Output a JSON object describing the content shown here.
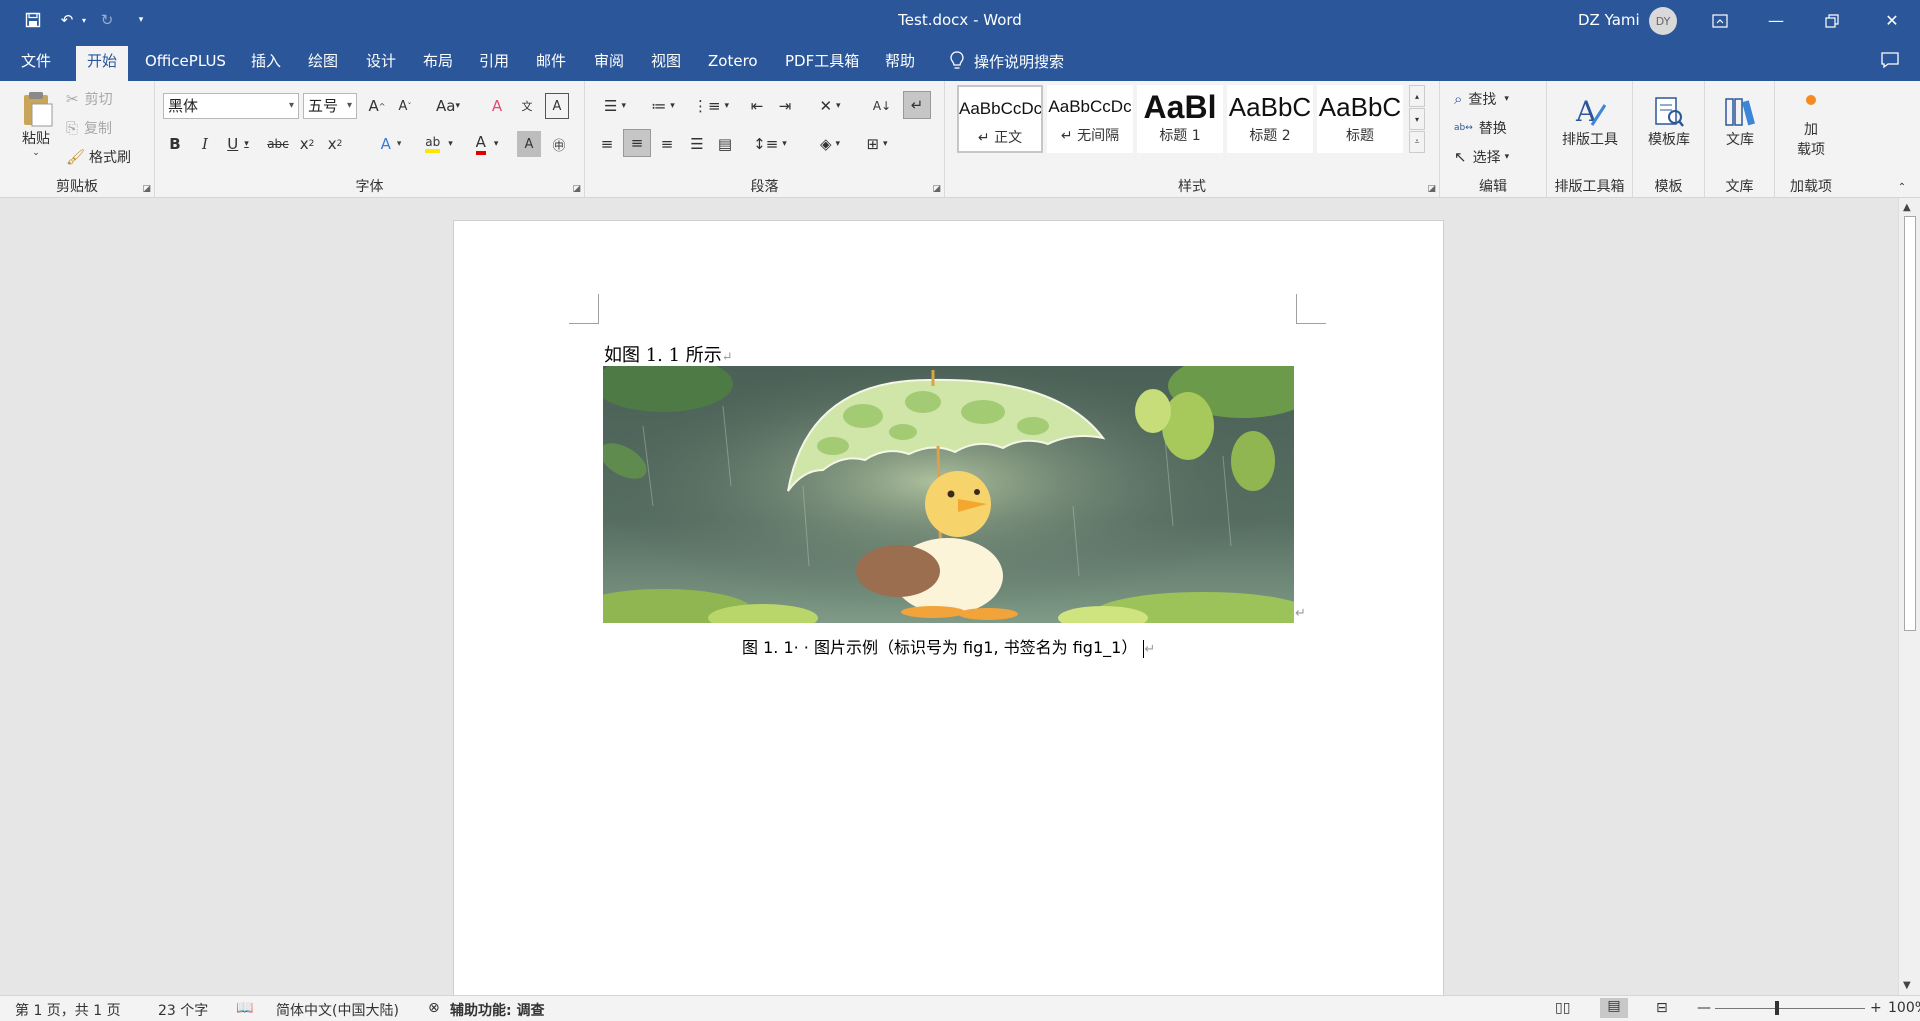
{
  "titlebar": {
    "title": "Test.docx - Word",
    "user": "DZ Yami",
    "avatar_initials": "DY",
    "qat": [
      "save-icon",
      "undo-icon",
      "redo-icon",
      "customize-qat-icon"
    ]
  },
  "tabs": [
    "文件",
    "开始",
    "OfficePLUS",
    "插入",
    "绘图",
    "设计",
    "布局",
    "引用",
    "邮件",
    "审阅",
    "视图",
    "Zotero",
    "PDF工具箱",
    "帮助"
  ],
  "active_tab": "开始",
  "tell_me": "操作说明搜索",
  "clipboard": {
    "paste": "粘贴",
    "cut": "剪切",
    "copy": "复制",
    "format_painter": "格式刷",
    "label": "剪贴板"
  },
  "font": {
    "name": "黑体",
    "size": "五号",
    "label": "字体"
  },
  "paragraph": {
    "label": "段落"
  },
  "styles": {
    "label": "样式",
    "items": [
      {
        "sample": "AaBbCcDc",
        "name": "↵ 正文"
      },
      {
        "sample": "AaBbCcDc",
        "name": "↵ 无间隔"
      },
      {
        "sample": "AaBl",
        "name": "标题 1"
      },
      {
        "sample": "AaBbC",
        "name": "标题 2"
      },
      {
        "sample": "AaBbC",
        "name": "标题"
      }
    ]
  },
  "editing": {
    "find": "查找",
    "replace": "替换",
    "select": "选择",
    "label": "编辑"
  },
  "typesetting": {
    "button": "排版工具",
    "label": "排版工具箱"
  },
  "templates": {
    "button": "模板库",
    "label": "模板"
  },
  "library": {
    "button": "文库",
    "label": "文库"
  },
  "addins": {
    "button_line1": "加",
    "button_line2": "载项",
    "label": "加载项"
  },
  "document": {
    "body_text": "如图 1. 1 所示",
    "caption": "图 1. 1· · 图片示例（标识号为 fig1, 书签名为 fig1_1）"
  },
  "status": {
    "page": "第 1 页，共 1 页",
    "words": "23 个字",
    "language": "简体中文(中国大陆)",
    "accessibility": "辅助功能: 调查",
    "zoom": "100%"
  }
}
